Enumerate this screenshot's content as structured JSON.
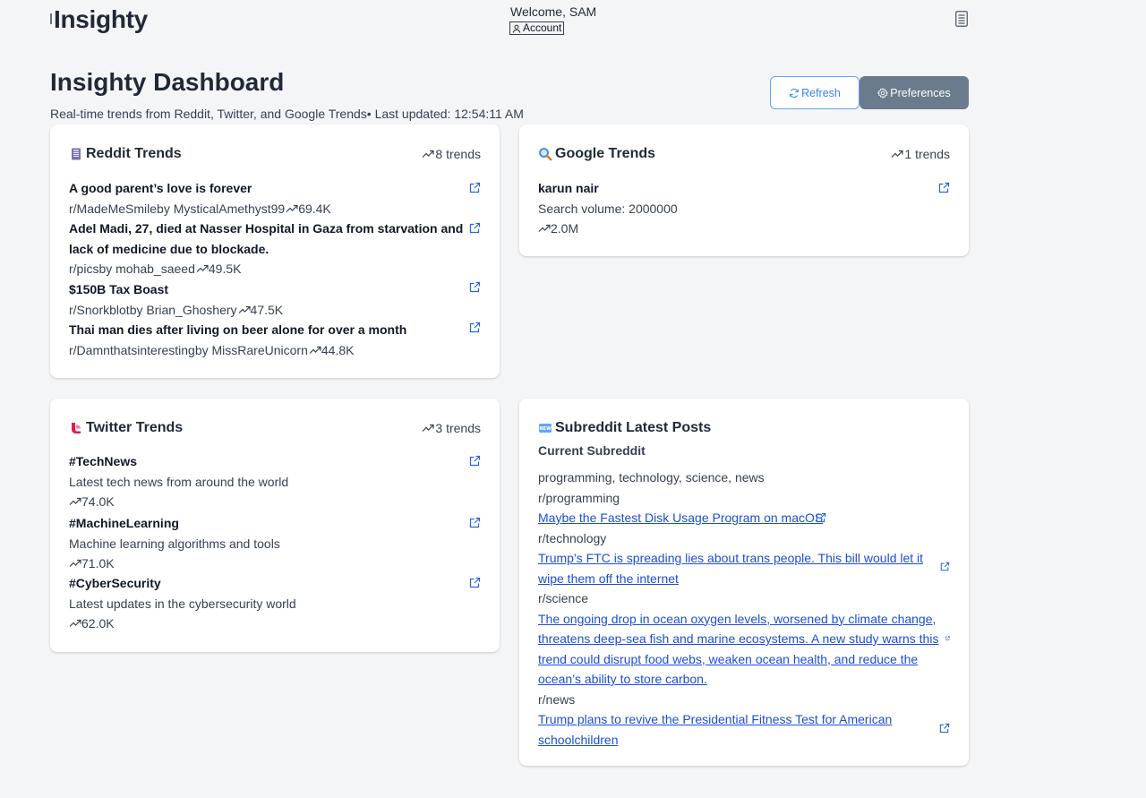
{
  "app": {
    "brand": "Insighty",
    "welcome": "Welcome, SAM",
    "account_label": "Account"
  },
  "page": {
    "title": "Insighty Dashboard",
    "subtitle": "Real-time trends from Reddit, Twitter, and Google Trends• Last updated: 12:54:11 AM",
    "refresh_label": "Refresh",
    "preferences_label": "Preferences"
  },
  "reddit": {
    "title": "Reddit Trends",
    "count": "8 trends",
    "items": [
      {
        "title": "A good parent’s love is forever",
        "meta": "r/MadeMeSmileby MysticalAmethyst99",
        "score": "69.4K"
      },
      {
        "title": "Adel Madi, 27, died at Nasser Hospital in Gaza from starvation and lack of medicine due to blockade.",
        "meta": "r/picsby mohab_saeed",
        "score": "49.5K"
      },
      {
        "title": "$150B Tax Boast",
        "meta": "r/Snorkblotby Brian_Ghoshery",
        "score": "47.5K"
      },
      {
        "title": "Thai man dies after living on beer alone for over a month",
        "meta": "r/Damnthatsinterestingby MissRareUnicorn",
        "score": "44.8K"
      }
    ]
  },
  "google": {
    "title": "Google Trends",
    "count": "1 trends",
    "items": [
      {
        "title": "karun nair",
        "volume": "Search volume: 2000000",
        "score": "2.0M"
      }
    ]
  },
  "twitter": {
    "title": "Twitter Trends",
    "count": "3 trends",
    "items": [
      {
        "title": "#TechNews",
        "desc": "Latest tech news from around the world",
        "score": "74.0K"
      },
      {
        "title": "#MachineLearning",
        "desc": "Machine learning algorithms and tools",
        "score": "71.0K"
      },
      {
        "title": "#CyberSecurity",
        "desc": "Latest updates in the cybersecurity world",
        "score": "62.0K"
      }
    ]
  },
  "subreddit": {
    "title": "Subreddit Latest Posts",
    "current_label": "Current Subreddit",
    "current_value": "programming, technology, science, news",
    "sections": [
      {
        "name": "r/programming",
        "post": "Maybe the Fastest Disk Usage Program on macOS"
      },
      {
        "name": "r/technology",
        "post": "Trump’s FTC is spreading lies about trans people. This bill would let it wipe them off the internet"
      },
      {
        "name": "r/science",
        "post": "The ongoing drop in ocean oxygen levels, worsened by climate change, threatens deep-sea fish and marine ecosystems. A new study warns this trend could disrupt food webs, weaken ocean health, and reduce the ocean’s ability to store carbon."
      },
      {
        "name": "r/news",
        "post": "Trump plans to revive the Presidential Fitness Test for American schoolchildren"
      }
    ]
  },
  "colors": {
    "accent_blue": "#3b82f6",
    "link_blue": "#1d4ed8",
    "preferences_bg": "#6b7a8d"
  }
}
